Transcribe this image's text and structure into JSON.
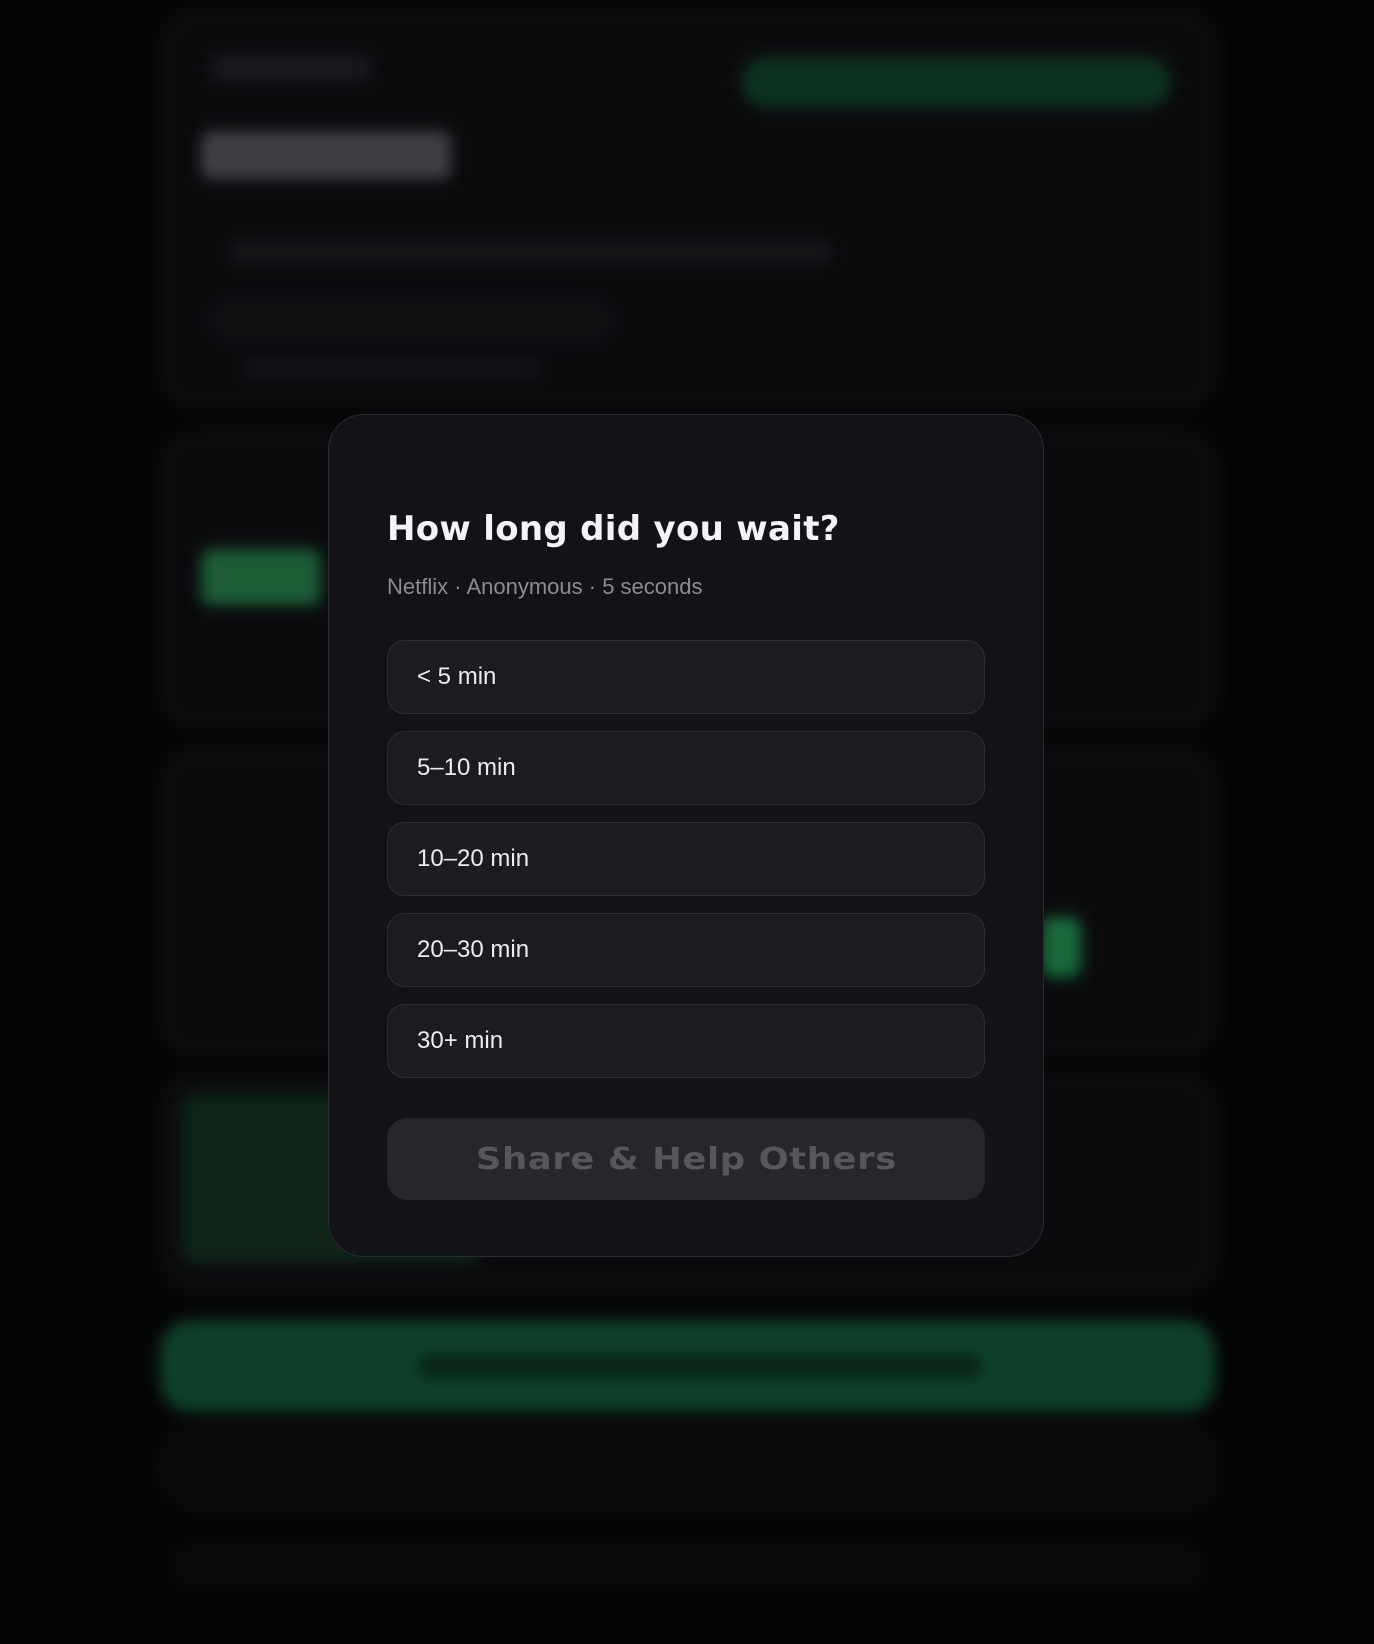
{
  "modal": {
    "title": "How long did you wait?",
    "subtitle": "Netflix · Anonymous · 5 seconds",
    "options": [
      {
        "label": "< 5 min"
      },
      {
        "label": "5–10 min"
      },
      {
        "label": "10–20 min"
      },
      {
        "label": "20–30 min"
      },
      {
        "label": "30+ min"
      }
    ],
    "submit_label": "Share & Help Others",
    "submit_disabled": true
  },
  "colors": {
    "backdrop": "#050506",
    "modal_bg": "#131317",
    "option_bg": "#1b1c21",
    "accent_green": "#0f4a30"
  }
}
